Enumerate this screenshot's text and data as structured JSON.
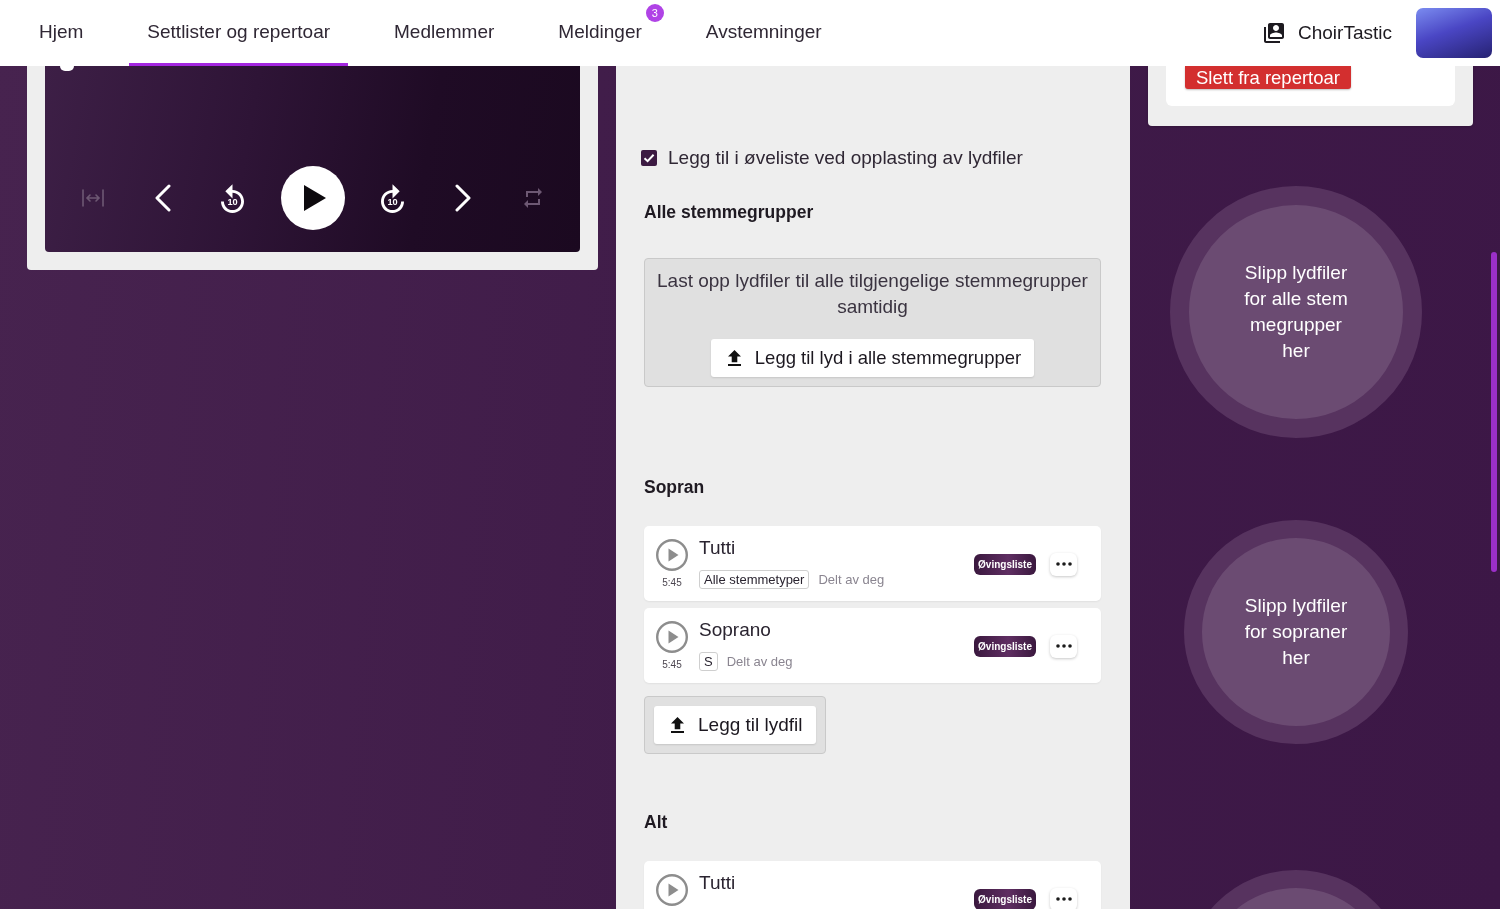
{
  "nav": {
    "tabs": [
      {
        "label": "Hjem",
        "selected": false
      },
      {
        "label": "Settlister og repertoar",
        "selected": true
      },
      {
        "label": "Medlemmer",
        "selected": false
      },
      {
        "label": "Meldinger",
        "selected": false,
        "badge": "3"
      },
      {
        "label": "Avstemninger",
        "selected": false
      }
    ],
    "app_name": "ChoirTastic"
  },
  "player": {
    "controls": [
      {
        "kind": "fit",
        "disabled": true
      },
      {
        "kind": "previous",
        "disabled": false
      },
      {
        "kind": "rewind",
        "label": "10",
        "disabled": false
      },
      {
        "kind": "play",
        "disabled": false
      },
      {
        "kind": "forward",
        "label": "10",
        "disabled": false
      },
      {
        "kind": "next",
        "disabled": false
      },
      {
        "kind": "repeat",
        "disabled": true
      }
    ]
  },
  "upload": {
    "add_to_practice_list": {
      "label": "Legg til i øveliste ved opplasting av lydfiler",
      "checked": true
    },
    "all_groups": {
      "heading": "Alle stemmegrupper",
      "description": "Last opp lydfiler til alle tilgjengelige stemmegrupper samtidig",
      "button": "Legg til lyd i alle stemmegrupper",
      "drop_zone": "Slipp lydfiler for alle stemmegrupper her"
    },
    "sections": [
      {
        "heading": "Sopran",
        "tracks": [
          {
            "title": "Tutti",
            "duration": "5:45",
            "tag": "Alle stemmetyper",
            "shared": "Delt av deg",
            "badge": "Øvingsliste"
          },
          {
            "title": "Soprano",
            "duration": "5:45",
            "tag": "S",
            "shared": "Delt av deg",
            "badge": "Øvingsliste"
          }
        ],
        "upload_button": "Legg til lydfil",
        "drop_zone": "Slipp lydfiler for sopraner her"
      },
      {
        "heading": "Alt",
        "tracks": [
          {
            "title": "Tutti",
            "badge": "Øvingsliste"
          }
        ]
      }
    ]
  },
  "repertoire": {
    "delete_button": "Slett fra repertoar"
  }
}
